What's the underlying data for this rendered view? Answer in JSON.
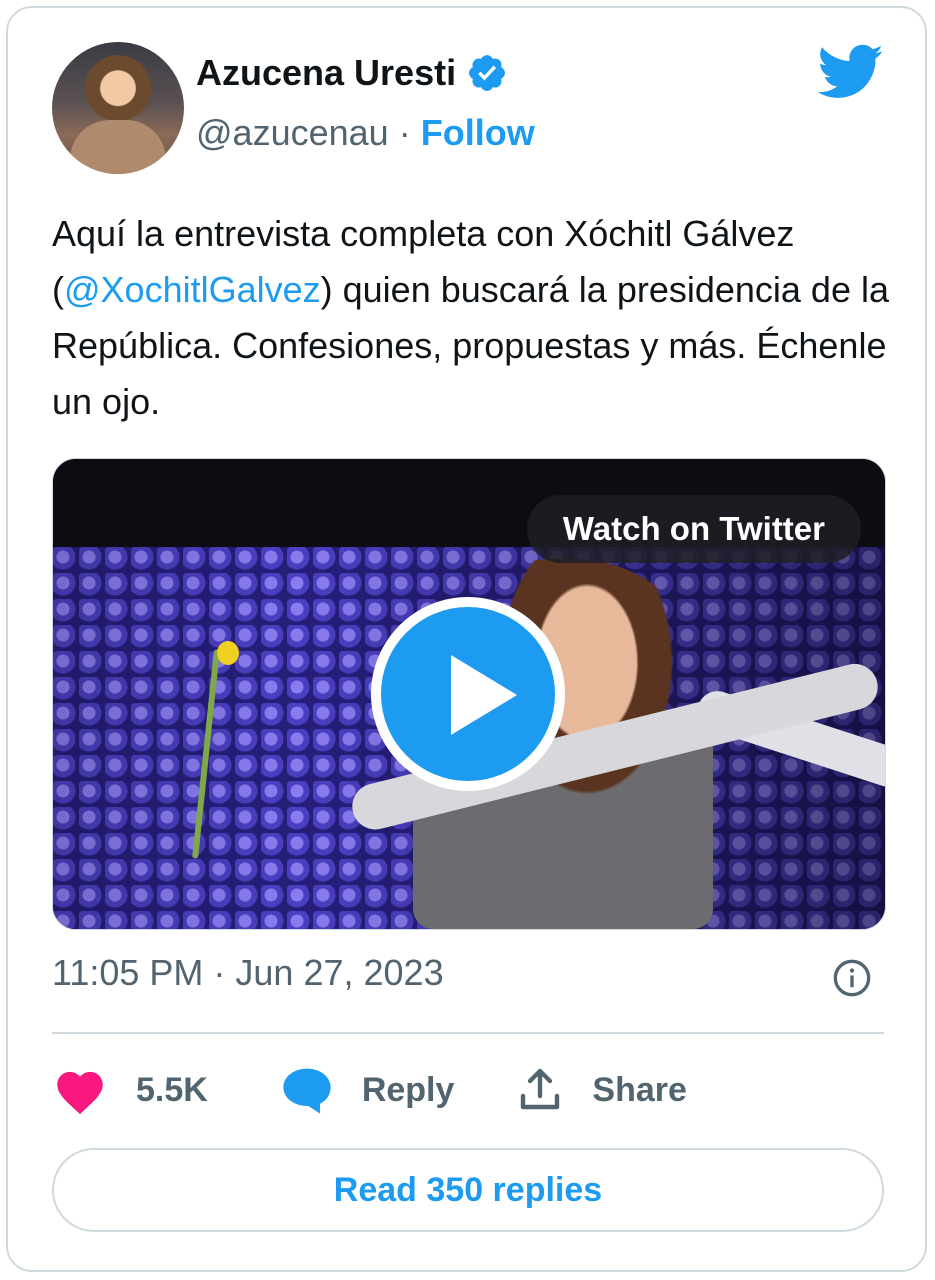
{
  "author": {
    "display_name": "Azucena Uresti",
    "handle": "@azucenau",
    "separator": "·",
    "follow_label": "Follow"
  },
  "tweet": {
    "text_part1": "Aquí la entrevista completa con Xóchitl Gálvez (",
    "mention": "@XochitlGalvez",
    "text_part2": ") quien buscará la presidencia de la República. Confesiones, propuestas y más. Échenle un ojo."
  },
  "media": {
    "watch_label": "Watch on Twitter"
  },
  "meta": {
    "timestamp": "11:05 PM · Jun 27, 2023"
  },
  "actions": {
    "likes": "5.5K",
    "reply_label": "Reply",
    "share_label": "Share"
  },
  "read_replies_label": "Read 350 replies",
  "colors": {
    "accent": "#1d9bf0",
    "like": "#f91880",
    "secondary_text": "#536471",
    "primary_text": "#0f1419"
  },
  "icons": [
    "verified-badge-icon",
    "twitter-bird-icon",
    "play-icon",
    "info-icon",
    "heart-icon",
    "reply-bubble-icon",
    "share-icon"
  ]
}
